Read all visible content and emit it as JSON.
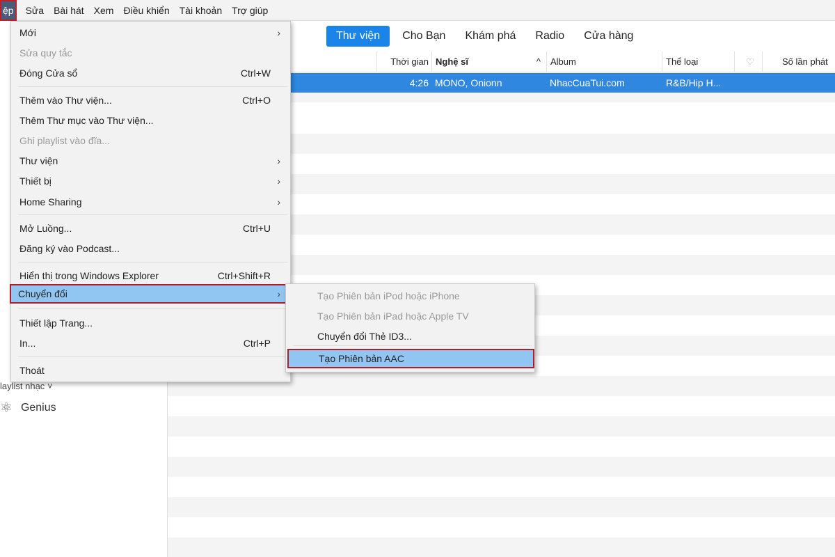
{
  "menubar": {
    "items": [
      "ệp",
      "Sửa",
      "Bài hát",
      "Xem",
      "Điều khiển",
      "Tài khoản",
      "Trợ giúp"
    ]
  },
  "tabs": [
    "Thư viện",
    "Cho Bạn",
    "Khám phá",
    "Radio",
    "Cửa hàng"
  ],
  "columns": [
    "Thời gian",
    "Nghệ sĩ",
    "Album",
    "Thể loại",
    "♡",
    "Số lần phát"
  ],
  "sort_indicator": "^",
  "row": {
    "time": "4:26",
    "artist": "MONO, Onionn",
    "album": "NhacCuaTui.com",
    "genre": "R&B/Hip H..."
  },
  "sidebar": {
    "section": "laylist nhạc",
    "section_chevron": "˅",
    "genius": "Genius"
  },
  "file_menu": [
    {
      "label": "Mới",
      "arrow": "›"
    },
    {
      "label": "Sửa quy tắc",
      "disabled": true
    },
    {
      "label": "Đóng Cửa sổ",
      "shortcut": "Ctrl+W"
    },
    {
      "label": "Thêm vào Thư viện...",
      "shortcut": "Ctrl+O"
    },
    {
      "label": "Thêm Thư mục vào Thư viện..."
    },
    {
      "label": "Ghi playlist vào đĩa...",
      "disabled": true
    },
    {
      "label": "Thư viện",
      "arrow": "›"
    },
    {
      "label": "Thiết bị",
      "arrow": "›"
    },
    {
      "label": "Home Sharing",
      "arrow": "›"
    },
    {
      "label": "Mở Luồng...",
      "shortcut": "Ctrl+U"
    },
    {
      "label": "Đăng ký vào Podcast..."
    },
    {
      "label": "Hiển thị trong Windows Explorer",
      "shortcut": "Ctrl+Shift+R"
    },
    {
      "label": "Chuyển đổi",
      "arrow": "›",
      "highlighted": true
    },
    {
      "label": "Thiết lập Trang..."
    },
    {
      "label": "In...",
      "shortcut": "Ctrl+P"
    },
    {
      "label": "Thoát"
    }
  ],
  "convert_submenu": [
    {
      "label": "Tạo Phiên bản iPod hoặc iPhone",
      "disabled": true
    },
    {
      "label": "Tạo Phiên bản iPad hoặc Apple TV",
      "disabled": true
    },
    {
      "label": "Chuyển đổi Thẻ ID3..."
    },
    {
      "label": "Tạo Phiên bản AAC",
      "highlighted": true
    }
  ],
  "colors": {
    "accent": "#1a84e8",
    "selection": "#2f87e0",
    "menu_highlight": "#91c6f3",
    "callout": "#b01c28"
  }
}
